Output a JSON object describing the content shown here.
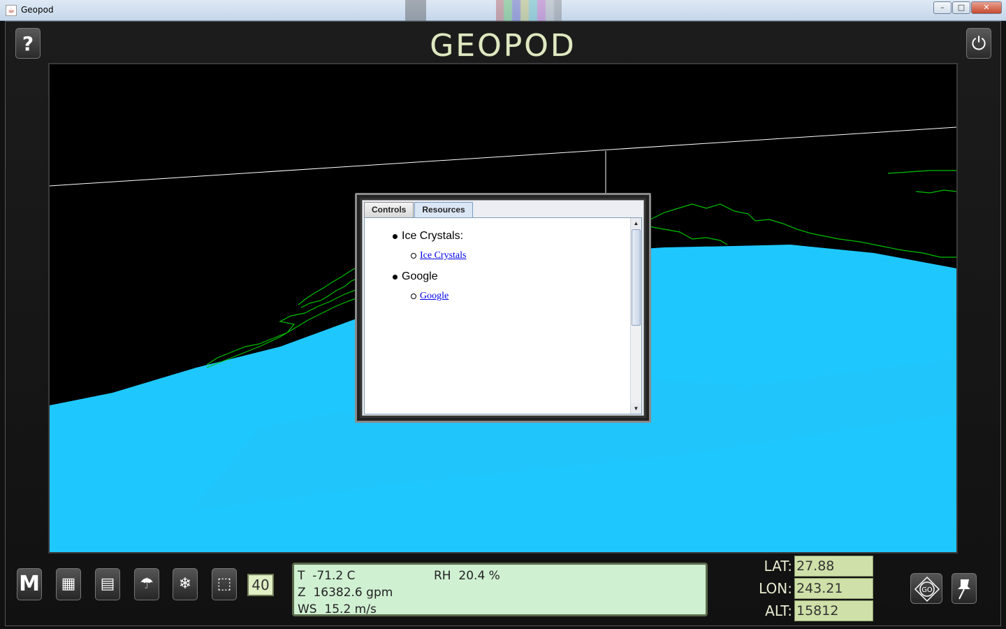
{
  "window": {
    "title": "Geopod",
    "app_icon": "java-cup-icon",
    "minimize": "–",
    "maximize": "□",
    "close": "✕"
  },
  "header": {
    "logo": "GEOPOD",
    "help_glyph": "?",
    "power_glyph": "⏻"
  },
  "viewport": {
    "surface_color": "#1ec8ff",
    "coastline_color": "#00c000",
    "grid_line_color": "#ffffff",
    "background_color": "#000000"
  },
  "dialog": {
    "tabs": [
      {
        "label": "Controls",
        "active": false
      },
      {
        "label": "Resources",
        "active": true
      }
    ],
    "resources": [
      {
        "heading": "Ice Crystals:",
        "link": "Ice Crystals"
      },
      {
        "heading": "Google",
        "link": "Google "
      }
    ],
    "scroll_up": "▲",
    "scroll_down": "▼"
  },
  "toolbar": {
    "menu_glyph": "M",
    "calculator_glyph": "▦",
    "notepad_glyph": "▤",
    "parachute_glyph": "☂",
    "snowflake_glyph": "❄",
    "cube_glyph": "⬚",
    "count_value": "40"
  },
  "readout": {
    "temperature": "T  -71.2 C",
    "relative_humidity": "RH  20.4 %",
    "geopotential": "Z  16382.6 gpm",
    "wind_speed": "WS  15.2 m/s"
  },
  "coordinates": {
    "lat_label": "LAT:",
    "lat_value": "27.88",
    "lon_label": "LON:",
    "lon_value": "243.21",
    "alt_label": "ALT:",
    "alt_value": "15812"
  },
  "nav": {
    "go_label": "GO",
    "pin_glyph": "📌"
  }
}
